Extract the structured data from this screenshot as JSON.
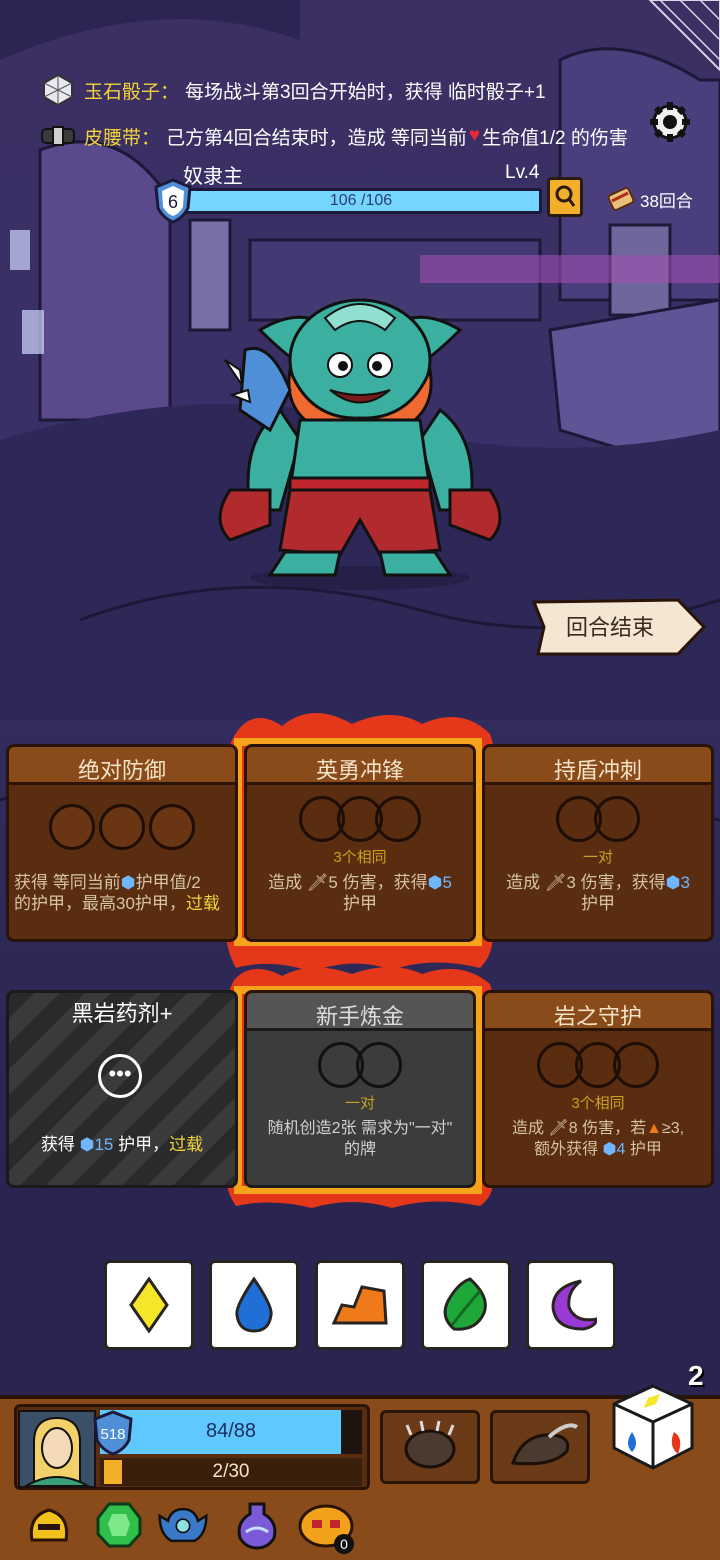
{
  "buffs": [
    {
      "name": "玉石骰子：",
      "text": "每场战斗第3回合开始时，获得 临时骰子+1"
    },
    {
      "name": "皮腰带：",
      "text_a": "己方第4回合结束时，造成 等同当前",
      "text_b": "生命值1/2 的伤害"
    }
  ],
  "boss": {
    "name": "奴隶主",
    "level": "Lv.4",
    "hp": "106 /106",
    "hp_fraction": 1.0,
    "shield": "6"
  },
  "turn_counter": "38回合",
  "end_turn_label": "回合结束",
  "cards": [
    {
      "title": "绝对防御",
      "req": "",
      "desc_a": "获得 等同当前",
      "desc_b": "护甲值",
      "desc_c": "/2",
      "desc_d": "的护甲，最高30护甲，",
      "desc_e": "过载"
    },
    {
      "title": "英勇冲锋",
      "req": "3个相同",
      "desc_a": "造成",
      "desc_b": "5 伤害，获得",
      "desc_c": "5",
      "desc_d": "护甲"
    },
    {
      "title": "持盾冲刺",
      "req": "一对",
      "desc_a": "造成",
      "desc_b": "3 伤害，获得",
      "desc_c": "3",
      "desc_d": "护甲"
    },
    {
      "title": "黑岩药剂+",
      "req": "",
      "desc_a": "获得",
      "desc_b": "15",
      "desc_c": "护甲，",
      "desc_d": "过载"
    },
    {
      "title": "新手炼金",
      "req": "一对",
      "desc_a": "随机创造2张 需求为\"一对\"",
      "desc_b": "的牌"
    },
    {
      "title": "岩之守护",
      "req": "3个相同",
      "desc_a": "造成",
      "desc_b": "8 伤害，若",
      "desc_c": "≥3,",
      "desc_d": "额外获得",
      "desc_e": "4",
      "desc_f": "护甲"
    }
  ],
  "dice": [
    {
      "icon": "yellow-diamond-icon",
      "color": "#f6e62a"
    },
    {
      "icon": "blue-drop-icon",
      "color": "#1f6fd6"
    },
    {
      "icon": "orange-rock-icon",
      "color": "#f07a1a"
    },
    {
      "icon": "green-leaf-icon",
      "color": "#1fa83a"
    },
    {
      "icon": "purple-moon-icon",
      "color": "#9a3ad6"
    }
  ],
  "player": {
    "armor": "518",
    "hp": "84/88",
    "hp_fraction": 0.955,
    "energy": "2/30"
  },
  "dice_remaining": "2",
  "relic_counter": "0"
}
